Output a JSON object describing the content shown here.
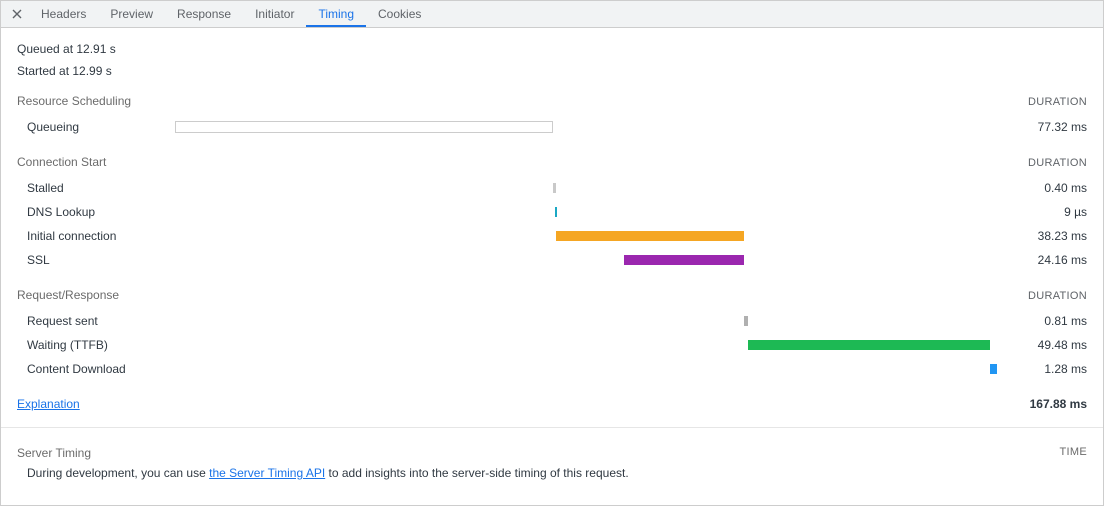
{
  "tabs": [
    "Headers",
    "Preview",
    "Response",
    "Initiator",
    "Timing",
    "Cookies"
  ],
  "active_tab": "Timing",
  "queued": "Queued at 12.91 s",
  "started": "Started at 12.99 s",
  "duration_header": "DURATION",
  "sections": {
    "resource_scheduling": {
      "title": "Resource Scheduling",
      "rows": [
        {
          "label": "Queueing",
          "value": "77.32 ms",
          "bar_class": "hollow",
          "left": 0,
          "width": 46.0
        }
      ]
    },
    "connection_start": {
      "title": "Connection Start",
      "rows": [
        {
          "label": "Stalled",
          "value": "0.40 ms",
          "bar_class": "c-stalled",
          "left": 46.0,
          "width": 0.3
        },
        {
          "label": "DNS Lookup",
          "value": "9 µs",
          "bar_class": "c-dns",
          "left": 46.2,
          "width": 0.3
        },
        {
          "label": "Initial connection",
          "value": "38.23 ms",
          "bar_class": "c-conn",
          "left": 46.4,
          "width": 22.8
        },
        {
          "label": "SSL",
          "value": "24.16 ms",
          "bar_class": "c-ssl",
          "left": 54.6,
          "width": 14.6
        }
      ]
    },
    "request_response": {
      "title": "Request/Response",
      "rows": [
        {
          "label": "Request sent",
          "value": "0.81 ms",
          "bar_class": "c-sent",
          "left": 69.2,
          "width": 0.5
        },
        {
          "label": "Waiting (TTFB)",
          "value": "49.48 ms",
          "bar_class": "c-wait",
          "left": 69.7,
          "width": 29.5
        },
        {
          "label": "Content Download",
          "value": "1.28 ms",
          "bar_class": "c-recv",
          "left": 99.2,
          "width": 0.8
        }
      ]
    }
  },
  "explanation_label": "Explanation",
  "total": "167.88 ms",
  "server_timing": {
    "title": "Server Timing",
    "time_header": "TIME",
    "body_prefix": "During development, you can use ",
    "body_link": "the Server Timing API",
    "body_suffix": " to add insights into the server-side timing of this request."
  },
  "chart_data": {
    "type": "bar",
    "title": "Network Request Timing Waterfall",
    "total_ms": 167.88,
    "series": [
      {
        "name": "Queueing",
        "start_ms": 0.0,
        "duration_ms": 77.32
      },
      {
        "name": "Stalled",
        "start_ms": 77.32,
        "duration_ms": 0.4
      },
      {
        "name": "DNS Lookup",
        "start_ms": 77.72,
        "duration_ms": 0.009
      },
      {
        "name": "Initial connection",
        "start_ms": 77.73,
        "duration_ms": 38.23
      },
      {
        "name": "SSL",
        "start_ms": 91.8,
        "duration_ms": 24.16
      },
      {
        "name": "Request sent",
        "start_ms": 115.96,
        "duration_ms": 0.81
      },
      {
        "name": "Waiting (TTFB)",
        "start_ms": 116.77,
        "duration_ms": 49.48
      },
      {
        "name": "Content Download",
        "start_ms": 166.25,
        "duration_ms": 1.28
      }
    ]
  }
}
